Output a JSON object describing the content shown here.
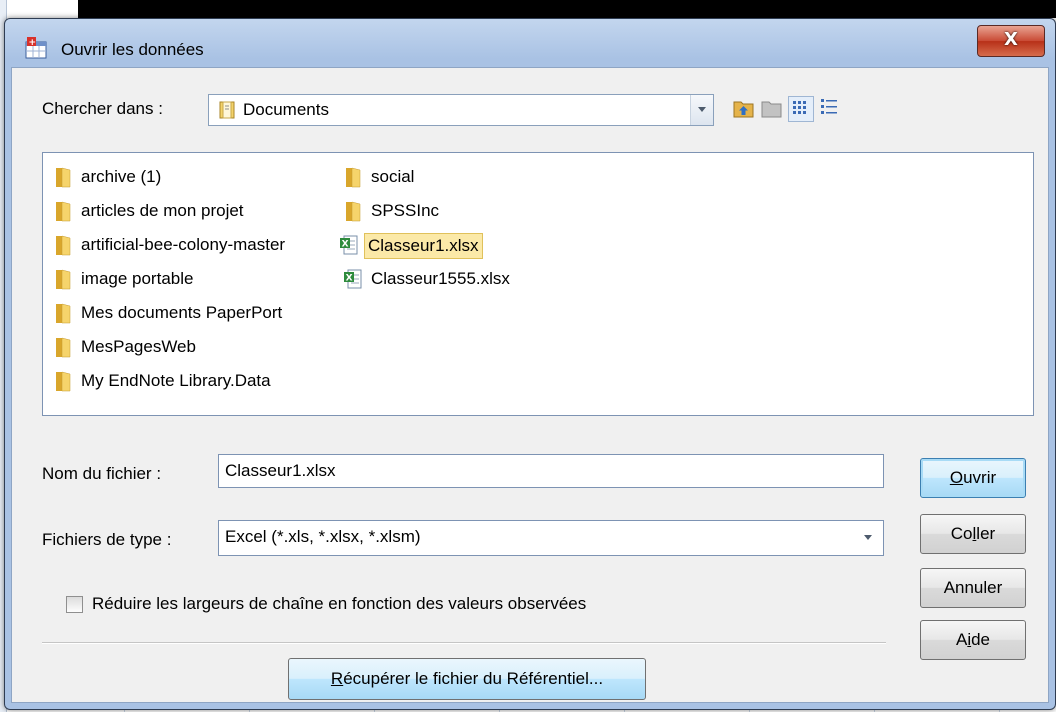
{
  "dialog": {
    "title": "Ouvrir les données",
    "close_label": "X"
  },
  "lookin": {
    "label": "Chercher dans :",
    "value": "Documents"
  },
  "toolbar": {
    "icons": [
      "up-folder-icon",
      "new-folder-icon",
      "list-view-icon",
      "details-view-icon"
    ]
  },
  "files": {
    "items": [
      {
        "name": "archive (1)",
        "type": "folder"
      },
      {
        "name": "articles de mon projet",
        "type": "folder"
      },
      {
        "name": "artificial-bee-colony-master",
        "type": "folder"
      },
      {
        "name": "image portable",
        "type": "folder"
      },
      {
        "name": "Mes documents PaperPort",
        "type": "folder"
      },
      {
        "name": "MesPagesWeb",
        "type": "folder"
      },
      {
        "name": "My EndNote Library.Data",
        "type": "folder"
      },
      {
        "name": "social",
        "type": "folder"
      },
      {
        "name": "SPSSInc",
        "type": "folder"
      },
      {
        "name": "Classeur1.xlsx",
        "type": "excel",
        "selected": true
      },
      {
        "name": "Classeur1555.xlsx",
        "type": "excel"
      }
    ]
  },
  "filename": {
    "label": "Nom du fichier :",
    "value": "Classeur1.xlsx"
  },
  "filetype": {
    "label": "Fichiers de type :",
    "value": "Excel (*.xls, *.xlsx, *.xlsm)"
  },
  "option": {
    "label": "Réduire les largeurs de chaîne en fonction des valeurs observées",
    "checked": false
  },
  "buttons": {
    "open": {
      "pre": "",
      "key": "O",
      "post": "uvrir"
    },
    "paste": {
      "pre": "Co",
      "key": "l",
      "post": "ler"
    },
    "cancel": "Annuler",
    "help": {
      "pre": "A",
      "key": "i",
      "post": "de"
    },
    "retrieve": {
      "pre": "",
      "key": "R",
      "post": "écupérer le fichier du Référentiel..."
    }
  }
}
